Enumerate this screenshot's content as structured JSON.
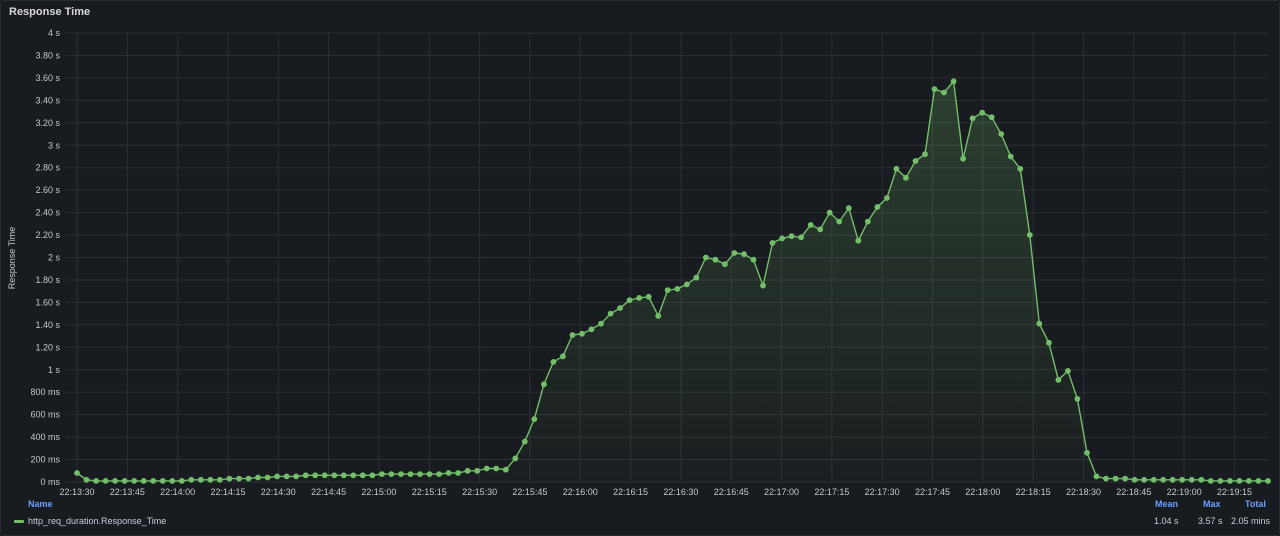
{
  "panel": {
    "title": "Response Time"
  },
  "chart_data": {
    "type": "area",
    "ylabel": "Response Time",
    "ylim": [
      0,
      4
    ],
    "y_ticks": [
      "0 ms",
      "200 ms",
      "400 ms",
      "600 ms",
      "800 ms",
      "1 s",
      "1.20 s",
      "1.40 s",
      "1.60 s",
      "1.80 s",
      "2 s",
      "2.20 s",
      "2.40 s",
      "2.60 s",
      "2.80 s",
      "3 s",
      "3.20 s",
      "3.40 s",
      "3.60 s",
      "3.80 s",
      "4 s"
    ],
    "x_ticks": [
      "22:13:30",
      "22:13:45",
      "22:14:00",
      "22:14:15",
      "22:14:30",
      "22:14:45",
      "22:15:00",
      "22:15:15",
      "22:15:30",
      "22:15:45",
      "22:16:00",
      "22:16:15",
      "22:16:30",
      "22:16:45",
      "22:17:00",
      "22:17:15",
      "22:17:30",
      "22:17:45",
      "22:18:00",
      "22:18:15",
      "22:18:30",
      "22:18:45",
      "22:19:00",
      "22:19:15"
    ],
    "x_start": "22:13:30",
    "x_end": "22:19:25",
    "grid": true,
    "series": [
      {
        "name": "http_req_duration.Response_Time",
        "color": "#73bf69",
        "values": [
          0.08,
          0.02,
          0.01,
          0.01,
          0.01,
          0.01,
          0.01,
          0.01,
          0.01,
          0.01,
          0.01,
          0.01,
          0.02,
          0.02,
          0.02,
          0.02,
          0.03,
          0.03,
          0.03,
          0.04,
          0.04,
          0.05,
          0.05,
          0.05,
          0.06,
          0.06,
          0.06,
          0.06,
          0.06,
          0.06,
          0.06,
          0.06,
          0.07,
          0.07,
          0.07,
          0.07,
          0.07,
          0.07,
          0.07,
          0.08,
          0.08,
          0.1,
          0.1,
          0.12,
          0.12,
          0.11,
          0.21,
          0.36,
          0.56,
          0.87,
          1.07,
          1.12,
          1.31,
          1.32,
          1.36,
          1.41,
          1.5,
          1.55,
          1.62,
          1.64,
          1.65,
          1.48,
          1.71,
          1.72,
          1.76,
          1.82,
          2.0,
          1.98,
          1.94,
          2.04,
          2.03,
          1.98,
          1.75,
          2.13,
          2.17,
          2.19,
          2.18,
          2.29,
          2.25,
          2.4,
          2.32,
          2.44,
          2.15,
          2.32,
          2.45,
          2.53,
          2.79,
          2.71,
          2.86,
          2.92,
          3.5,
          3.47,
          3.57,
          2.88,
          3.24,
          3.29,
          3.25,
          3.1,
          2.9,
          2.79,
          2.2,
          1.41,
          1.24,
          0.91,
          0.99,
          0.74,
          0.26,
          0.05,
          0.03,
          0.03,
          0.03,
          0.02,
          0.02,
          0.02,
          0.02,
          0.02,
          0.02,
          0.02,
          0.02,
          0.01,
          0.01,
          0.01,
          0.01,
          0.01,
          0.01,
          0.01
        ]
      }
    ]
  },
  "legend": {
    "headers": {
      "name": "Name",
      "mean": "Mean",
      "max": "Max",
      "total": "Total"
    },
    "rows": [
      {
        "name": "http_req_duration.Response_Time",
        "mean": "1.04 s",
        "max": "3.57 s",
        "total": "2.05 mins"
      }
    ]
  }
}
